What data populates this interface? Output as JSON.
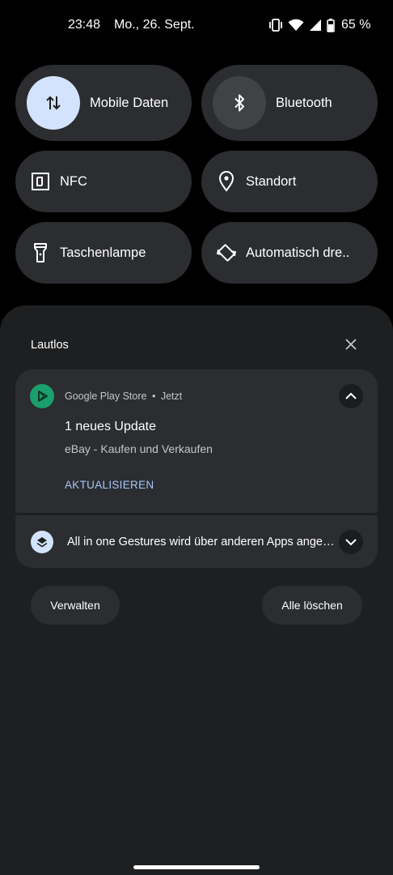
{
  "status": {
    "time": "23:48",
    "date": "Mo., 26. Sept.",
    "battery": "65 %"
  },
  "tiles": {
    "mobile_data": {
      "label": "Mobile Daten",
      "icon": "mobile-data-arrows-icon",
      "active": true
    },
    "bluetooth": {
      "label": "Bluetooth",
      "icon": "bluetooth-icon",
      "active": false
    },
    "nfc": {
      "label": "NFC",
      "icon": "nfc-icon"
    },
    "location": {
      "label": "Standort",
      "icon": "location-pin-icon"
    },
    "flashlight": {
      "label": "Taschenlampe",
      "icon": "flashlight-icon"
    },
    "autorotate": {
      "label": "Automatisch dre..",
      "icon": "auto-rotate-icon"
    }
  },
  "notifications": {
    "section_title": "Lautlos",
    "items": [
      {
        "app": "Google Play Store",
        "time": "Jetzt",
        "title": "1 neues Update",
        "text": "eBay - Kaufen und Verkaufen",
        "action": "AKTUALISIEREN"
      },
      {
        "text": "All in one Gestures wird über anderen Apps ange…"
      }
    ],
    "separator": "•"
  },
  "buttons": {
    "manage": "Verwalten",
    "clear_all": "Alle löschen"
  },
  "colors": {
    "accent": "#d3e3fd",
    "tile_bg": "#2b2d30",
    "shade_bg": "#1e1f21",
    "play_store_green": "#1b9f6f",
    "action_blue": "#a8c7fa"
  }
}
